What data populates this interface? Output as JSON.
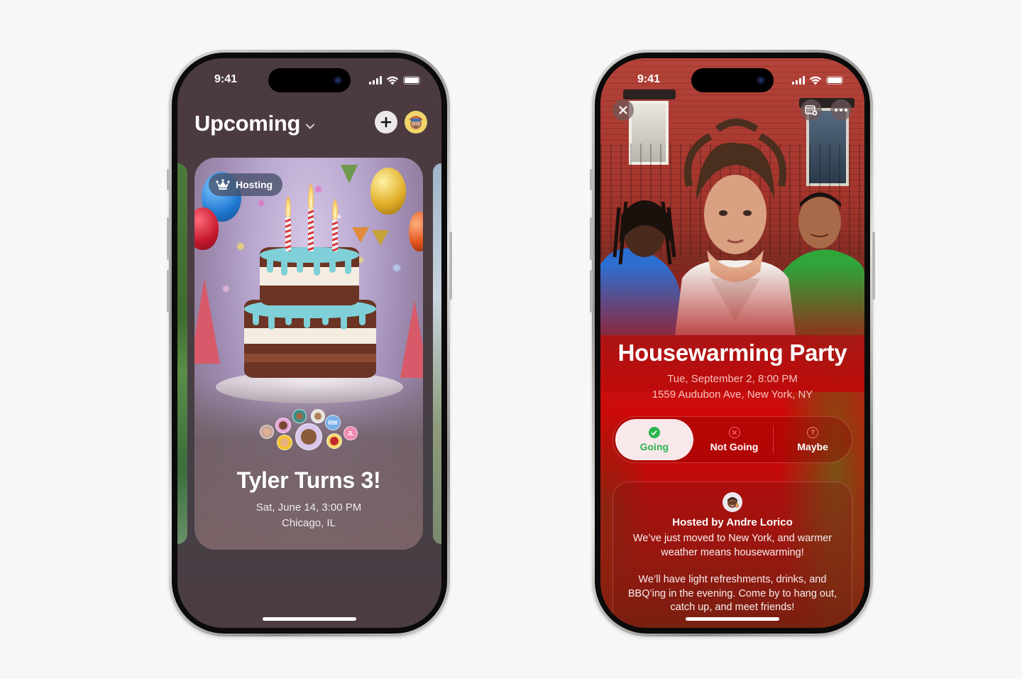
{
  "left_phone": {
    "status_bar": {
      "time": "9:41",
      "icons": [
        "cellular-signal-icon",
        "wifi-icon",
        "battery-icon"
      ]
    },
    "header": {
      "title": "Upcoming",
      "dropdown_icon": "chevron-down-icon",
      "add_button_icon": "plus-icon",
      "profile_button_icon": "memoji-avatar-icon"
    },
    "event_card": {
      "badge": {
        "icon": "crown-icon",
        "label": "Hosting"
      },
      "guests": [
        {
          "type": "memoji",
          "color": "#d9c7ea"
        },
        {
          "type": "memoji",
          "color": "#e7a6dc"
        },
        {
          "type": "memoji",
          "color": "#3a8f8a"
        },
        {
          "type": "memoji",
          "color": "#e8e2dc"
        },
        {
          "type": "initials",
          "initials": "RW",
          "color": "#7aaee8"
        },
        {
          "type": "initials",
          "initials": "JL",
          "color": "#ef8ab0"
        },
        {
          "type": "memoji",
          "color": "#f2c12e"
        },
        {
          "type": "memoji",
          "color": "#f6d76b"
        },
        {
          "type": "memoji",
          "color": "#c8a79e"
        }
      ],
      "title": "Tyler Turns 3!",
      "date": "Sat, June 14, 3:00 PM",
      "location": "Chicago, IL"
    }
  },
  "right_phone": {
    "status_bar": {
      "time": "9:41",
      "icons": [
        "cellular-signal-icon",
        "wifi-icon",
        "battery-icon"
      ]
    },
    "toolbar": {
      "close_icon": "close-icon",
      "calendar_icon": "add-to-calendar-icon",
      "more_icon": "more-icon"
    },
    "event": {
      "title": "Housewarming Party",
      "date": "Tue, September 2, 8:00 PM",
      "address": "1559 Audubon Ave, New York, NY"
    },
    "rsvp": {
      "selected": "Going",
      "options": [
        {
          "label": "Going",
          "icon": "checkmark-circle-icon",
          "color": "#2bb54f"
        },
        {
          "label": "Not Going",
          "icon": "x-circle-icon",
          "color": "#ff5a5a"
        },
        {
          "label": "Maybe",
          "icon": "question-circle-icon",
          "color": "#ff7a6a"
        }
      ]
    },
    "host": {
      "avatar_icon": "memoji-avatar-icon",
      "name": "Hosted by Andre Lorico",
      "description_1": "We’ve just moved to New York, and warmer weather means housewarming!",
      "description_2": "We’ll have light refreshments, drinks, and BBQ’ing in the evening. Come by to hang out, catch up, and meet friends!"
    }
  }
}
